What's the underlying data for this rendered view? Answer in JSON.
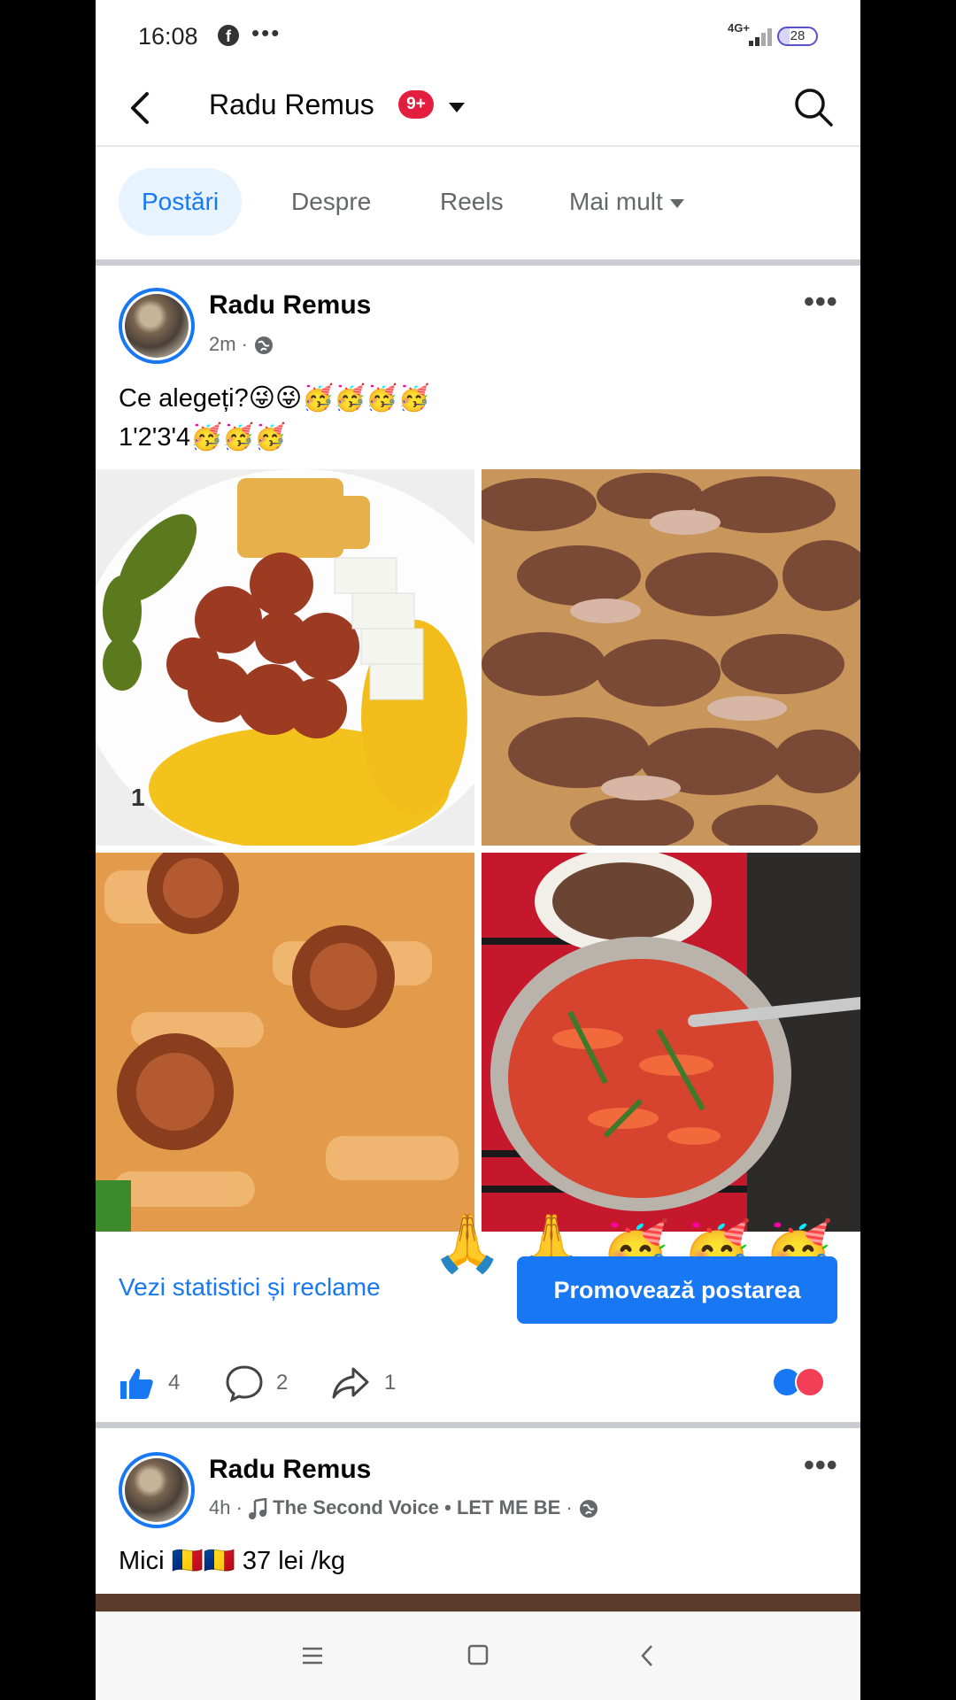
{
  "status_bar": {
    "time": "16:08",
    "network": "4G+",
    "battery": "28"
  },
  "header": {
    "title": "Radu Remus",
    "badge": "9+"
  },
  "tabs": [
    {
      "label": "Postări",
      "active": true
    },
    {
      "label": "Despre"
    },
    {
      "label": "Reels"
    },
    {
      "label": "Mai mult"
    }
  ],
  "post1": {
    "author": "Radu Remus",
    "time": "2m",
    "text_line1": "Ce alegeți?😜😜🥳🥳🥳🥳",
    "text_line2": "1'2'3'4🥳🥳🥳",
    "photo_label": "1",
    "emoji_overlay": [
      "🙏",
      "🙏",
      "🥳",
      "🥳",
      "🥳"
    ],
    "stats_link": "Vezi statistici și reclame",
    "promote_button": "Promovează postarea",
    "likes": "4",
    "comments": "2",
    "shares": "1"
  },
  "post2": {
    "author": "Radu Remus",
    "time": "4h",
    "music": "The Second Voice • LET ME BE",
    "text": "Mici 🇷🇴🇷🇴 37 lei /kg"
  },
  "colors": {
    "accent": "#1877f2",
    "badge": "#e41e3f",
    "divider": "#c9ccd1"
  },
  "icons": [
    "back-icon",
    "search-icon",
    "globe-icon",
    "more-icon",
    "like-icon",
    "comment-icon",
    "share-icon",
    "music-note-icon",
    "menu-icon",
    "home-icon",
    "nav-back-icon"
  ]
}
